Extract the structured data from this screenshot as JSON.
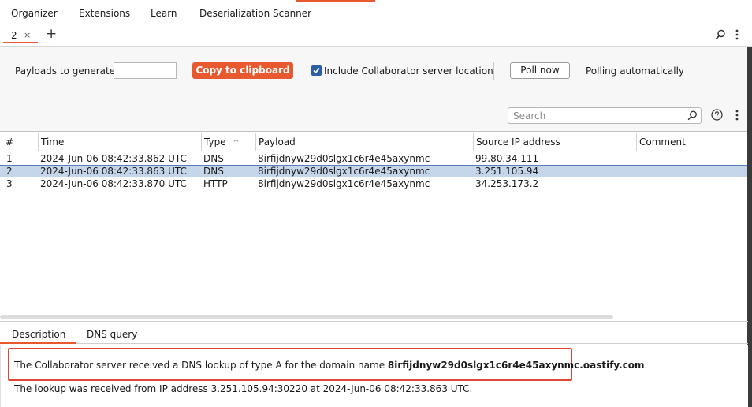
{
  "top_menu": {
    "items": [
      {
        "label": "Organizer"
      },
      {
        "label": "Extensions"
      },
      {
        "label": "Learn"
      },
      {
        "label": "Deserialization Scanner"
      }
    ]
  },
  "tab_strip": {
    "tabs": [
      {
        "label": "2",
        "close": "×"
      }
    ],
    "add_label": "+",
    "icons": [
      "search-icon",
      "more-vert-icon"
    ]
  },
  "controls": {
    "payloads_label": "Payloads to generate:",
    "payloads_value": "",
    "copy_button": "Copy to clipboard",
    "include_checkbox_checked": true,
    "include_label": "Include Collaborator server location",
    "poll_button": "Poll now",
    "polling_status": "Polling automatically"
  },
  "search": {
    "placeholder": "Search",
    "icons": [
      "search-icon",
      "help-icon",
      "more-vert-icon"
    ]
  },
  "table": {
    "columns": [
      "#",
      "Time",
      "Type",
      "Payload",
      "Source IP address",
      "Comment"
    ],
    "sort_indicator": "^",
    "rows": [
      {
        "num": "1",
        "time": "2024-Jun-06 08:42:33.862 UTC",
        "type": "DNS",
        "payload": "8irfijdnyw29d0slgx1c6r4e45axynmc",
        "ip": "99.80.34.111",
        "comment": ""
      },
      {
        "num": "2",
        "time": "2024-Jun-06 08:42:33.863 UTC",
        "type": "DNS",
        "payload": "8irfijdnyw29d0slgx1c6r4e45axynmc",
        "ip": "3.251.105.94",
        "comment": ""
      },
      {
        "num": "3",
        "time": "2024-Jun-06 08:42:33.870 UTC",
        "type": "HTTP",
        "payload": "8irfijdnyw29d0slgx1c6r4e45axynmc",
        "ip": "34.253.173.2",
        "comment": ""
      }
    ],
    "selected_row": "2"
  },
  "bottom": {
    "tabs": [
      {
        "label": "Description"
      },
      {
        "label": "DNS query"
      }
    ],
    "description": {
      "line1_prefix": "The Collaborator server received a DNS lookup of type A for the domain name ",
      "line1_domain": "8irfijdnyw29d0slgx1c6r4e45axynmc.oastify.com",
      "line1_suffix": ".",
      "line2": "The lookup was received from IP address 3.251.105.94:30220 at 2024-Jun-06 08:42:33.863 UTC."
    }
  },
  "colors": {
    "accent": "#e8592f",
    "selection": "#c5d5ea",
    "highlight_border": "#e04535",
    "checkbox": "#2a5fa8"
  }
}
